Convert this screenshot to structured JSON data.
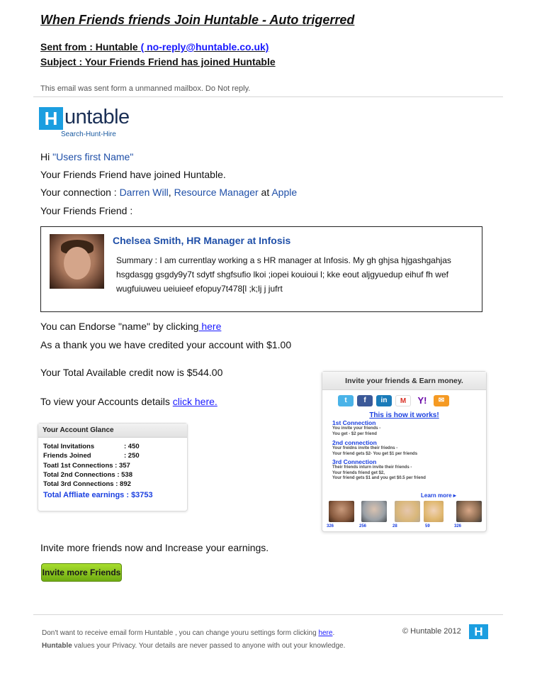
{
  "header": {
    "title": "When Friends friends Join Huntable -  Auto trigerred",
    "sent_from_label": "Sent from : Huntable",
    "sent_from_email": "( no-reply@huntable.co.uk)",
    "subject": "Subject  : Your Friends Friend has joined Huntable"
  },
  "notice": "This email was sent form a unmanned mailbox. Do Not reply.",
  "logo": {
    "letter": "H",
    "word": "untable",
    "tagline": "Search-Hunt-Hire"
  },
  "greeting": {
    "hi": "Hi",
    "name": "\"Users first Name\""
  },
  "body": {
    "joined_line": "Your Friends Friend have joined Huntable.",
    "connection_prefix": "Your connection : ",
    "connection_name": "Darren Will",
    "connection_sep": ", ",
    "connection_role": "Resource Manager",
    "connection_at": " at ",
    "connection_company": "Apple",
    "friends_friend_label": "Your Friends Friend :",
    "endorse_text": "You can Endorse \"name\" by clicking",
    "endorse_link": " here",
    "credit_line": "As a thank you we have credited your account with $1.00",
    "total_credit": "Your Total Available credit now is $544.00",
    "accounts_text": "To view your Accounts details ",
    "accounts_link": "click here. ",
    "invite_more_line": "Invite more friends now and Increase your earnings.",
    "invite_button": "Invite more Friends"
  },
  "profile_card": {
    "name": "Chelsea Smith, HR Manager at Infosis",
    "summary": "Summary :  I am currentlay working a s HR manager at Infosis. My gh ghjsa hjgashgahjas hsgdasgg gsgdy9y7t sdytf shgfsufio lkoi ;iopei kouioui l; kke eout aljgyuedup eihuf  fh wef wugfuiuweu  ueiuieef efopuy7t478[l  ;k;lj j jufrt"
  },
  "account_glance": {
    "title": "Your Account Glance",
    "rows": [
      {
        "label": "Total Invitations",
        "value": ": 450"
      },
      {
        "label": "Friends Joined",
        "value": ": 250"
      },
      {
        "label": "Toatl 1st Connections",
        "value": ": 357"
      },
      {
        "label": "Total 2nd Connections",
        "value": ": 538"
      },
      {
        "label": "Total 3rd Connections",
        "value": ": 892"
      }
    ],
    "total_label": "Total Affliate earnings : $3753"
  },
  "invite_panel": {
    "title": "Invite your friends & Earn money.",
    "icons": [
      "twitter-icon",
      "facebook-icon",
      "linkedin-icon",
      "gmail-icon",
      "yahoo-icon",
      "email-icon"
    ],
    "how_title": "This is how it works!",
    "steps": [
      {
        "title": "1st Connection",
        "lines": [
          "You invite your friends -",
          "You get - $2 per friend"
        ]
      },
      {
        "title": "2nd connection",
        "lines": [
          "Your freidns invite their friedns -",
          "Your friend gets $2- You get $1 per friends"
        ]
      },
      {
        "title": "3rd Connection",
        "lines": [
          "Their friends inturn invite their friends -",
          "Your friends friend get $2,",
          "Your friend gets $1 and you get $0.5 per friend"
        ]
      }
    ],
    "learn_more": "Learn more ▸",
    "people_counts": [
      "326",
      "256",
      "28",
      "59",
      "326"
    ]
  },
  "footer": {
    "unsubscribe_text": "Don't want to receive email form Huntable , you can change youru settings form clicking ",
    "unsubscribe_link": "here",
    "unsubscribe_end": ".",
    "privacy_brand": "Huntable",
    "privacy_text": " values your Privacy. Your details are never passed to anyone with out your knowledge.",
    "copyright": "© Huntable 2012",
    "logo_letter": "H"
  }
}
